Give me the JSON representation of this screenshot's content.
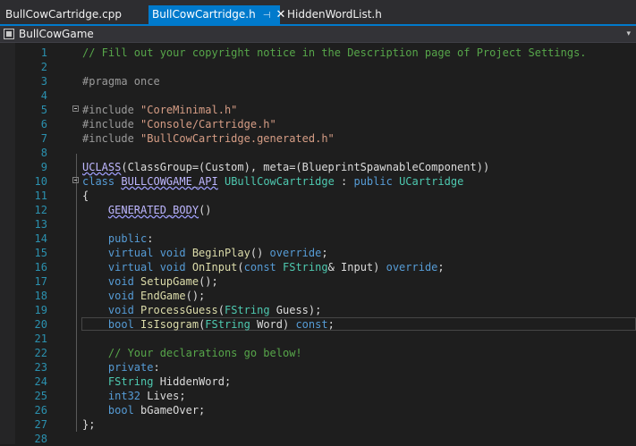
{
  "tabs": [
    {
      "label": "BullCowCartridge.cpp",
      "active": false
    },
    {
      "label": "BullCowCartridge.h",
      "active": true,
      "pin_glyph": "⊣",
      "close_glyph": "✕"
    },
    {
      "label": "HiddenWordList.h",
      "active": false
    }
  ],
  "navigation": {
    "project": "BullCowGame",
    "dropdown_glyph": "▾"
  },
  "colors": {
    "accent": "#007acc",
    "comment": "#57a64a",
    "keyword": "#569cd6",
    "string": "#d69d85",
    "type": "#4ec9b0",
    "function": "#dcdcaa",
    "macro": "#beb7ff",
    "line_number": "#2b91af"
  },
  "editor": {
    "current_line": 20,
    "lines": [
      {
        "n": "1",
        "tokens": [
          {
            "t": "// Fill out your copyright notice in the Description page of Project Settings.",
            "c": "cmt"
          }
        ]
      },
      {
        "n": "2",
        "tokens": []
      },
      {
        "n": "3",
        "tokens": [
          {
            "t": "#pragma once",
            "c": "pp"
          }
        ]
      },
      {
        "n": "4",
        "tokens": []
      },
      {
        "n": "5",
        "fold": true,
        "tokens": [
          {
            "t": "#include ",
            "c": "pp"
          },
          {
            "t": "\"CoreMinimal.h\"",
            "c": "str"
          }
        ]
      },
      {
        "n": "6",
        "tokens": [
          {
            "t": "#include ",
            "c": "pp"
          },
          {
            "t": "\"Console/Cartridge.h\"",
            "c": "str"
          }
        ]
      },
      {
        "n": "7",
        "tokens": [
          {
            "t": "#include ",
            "c": "pp"
          },
          {
            "t": "\"BullCowCartridge.generated.h\"",
            "c": "str"
          }
        ]
      },
      {
        "n": "8",
        "tokens": []
      },
      {
        "n": "9",
        "tokens": [
          {
            "t": "UCLASS",
            "c": "mac ul"
          },
          {
            "t": "(ClassGroup=(Custom), meta=(BlueprintSpawnableComponent))",
            "c": "txt"
          }
        ]
      },
      {
        "n": "10",
        "fold": true,
        "tokens": [
          {
            "t": "class ",
            "c": "kw"
          },
          {
            "t": "BULLCOWGAME_API",
            "c": "mac ul"
          },
          {
            "t": " ",
            "c": "txt"
          },
          {
            "t": "UBullCowCartridge",
            "c": "typ"
          },
          {
            "t": " : ",
            "c": "txt"
          },
          {
            "t": "public ",
            "c": "kw"
          },
          {
            "t": "UCartridge",
            "c": "typ"
          }
        ]
      },
      {
        "n": "11",
        "tokens": [
          {
            "t": "{",
            "c": "txt"
          }
        ]
      },
      {
        "n": "12",
        "tokens": [
          {
            "t": "    ",
            "c": "txt"
          },
          {
            "t": "GENERATED_BODY",
            "c": "mac ul"
          },
          {
            "t": "()",
            "c": "txt"
          }
        ]
      },
      {
        "n": "13",
        "tokens": []
      },
      {
        "n": "14",
        "tokens": [
          {
            "t": "    ",
            "c": "txt"
          },
          {
            "t": "public",
            "c": "kw"
          },
          {
            "t": ":",
            "c": "txt"
          }
        ]
      },
      {
        "n": "15",
        "tokens": [
          {
            "t": "    ",
            "c": "txt"
          },
          {
            "t": "virtual ",
            "c": "kw"
          },
          {
            "t": "void ",
            "c": "kw"
          },
          {
            "t": "BeginPlay",
            "c": "fn"
          },
          {
            "t": "() ",
            "c": "txt"
          },
          {
            "t": "override",
            "c": "kw"
          },
          {
            "t": ";",
            "c": "txt"
          }
        ]
      },
      {
        "n": "16",
        "tokens": [
          {
            "t": "    ",
            "c": "txt"
          },
          {
            "t": "virtual ",
            "c": "kw"
          },
          {
            "t": "void ",
            "c": "kw"
          },
          {
            "t": "OnInput",
            "c": "fn"
          },
          {
            "t": "(",
            "c": "txt"
          },
          {
            "t": "const ",
            "c": "kw"
          },
          {
            "t": "FString",
            "c": "typ"
          },
          {
            "t": "& Input) ",
            "c": "txt"
          },
          {
            "t": "override",
            "c": "kw"
          },
          {
            "t": ";",
            "c": "txt"
          }
        ]
      },
      {
        "n": "17",
        "tokens": [
          {
            "t": "    ",
            "c": "txt"
          },
          {
            "t": "void ",
            "c": "kw"
          },
          {
            "t": "SetupGame",
            "c": "fn"
          },
          {
            "t": "();",
            "c": "txt"
          }
        ]
      },
      {
        "n": "18",
        "tokens": [
          {
            "t": "    ",
            "c": "txt"
          },
          {
            "t": "void ",
            "c": "kw"
          },
          {
            "t": "EndGame",
            "c": "fn"
          },
          {
            "t": "();",
            "c": "txt"
          }
        ]
      },
      {
        "n": "19",
        "tokens": [
          {
            "t": "    ",
            "c": "txt"
          },
          {
            "t": "void ",
            "c": "kw"
          },
          {
            "t": "ProcessGuess",
            "c": "fn"
          },
          {
            "t": "(",
            "c": "txt"
          },
          {
            "t": "FString",
            "c": "typ"
          },
          {
            "t": " Guess);",
            "c": "txt"
          }
        ]
      },
      {
        "n": "20",
        "tokens": [
          {
            "t": "    ",
            "c": "txt"
          },
          {
            "t": "bool ",
            "c": "kw"
          },
          {
            "t": "IsIsogram",
            "c": "fn"
          },
          {
            "t": "(",
            "c": "txt"
          },
          {
            "t": "FString",
            "c": "typ"
          },
          {
            "t": " Word) ",
            "c": "txt"
          },
          {
            "t": "const",
            "c": "kw"
          },
          {
            "t": ";",
            "c": "txt"
          }
        ]
      },
      {
        "n": "21",
        "tokens": []
      },
      {
        "n": "22",
        "tokens": [
          {
            "t": "    ",
            "c": "txt"
          },
          {
            "t": "// Your declarations go below!",
            "c": "cmt"
          }
        ]
      },
      {
        "n": "23",
        "tokens": [
          {
            "t": "    ",
            "c": "txt"
          },
          {
            "t": "private",
            "c": "kw"
          },
          {
            "t": ":",
            "c": "txt"
          }
        ]
      },
      {
        "n": "24",
        "tokens": [
          {
            "t": "    ",
            "c": "txt"
          },
          {
            "t": "FString",
            "c": "typ"
          },
          {
            "t": " HiddenWord;",
            "c": "txt"
          }
        ]
      },
      {
        "n": "25",
        "tokens": [
          {
            "t": "    ",
            "c": "txt"
          },
          {
            "t": "int32",
            "c": "kw"
          },
          {
            "t": " Lives;",
            "c": "txt"
          }
        ]
      },
      {
        "n": "26",
        "tokens": [
          {
            "t": "    ",
            "c": "txt"
          },
          {
            "t": "bool ",
            "c": "kw"
          },
          {
            "t": "bGameOver;",
            "c": "txt"
          }
        ]
      },
      {
        "n": "27",
        "tokens": [
          {
            "t": "};",
            "c": "txt"
          }
        ]
      },
      {
        "n": "28",
        "tokens": []
      }
    ]
  }
}
